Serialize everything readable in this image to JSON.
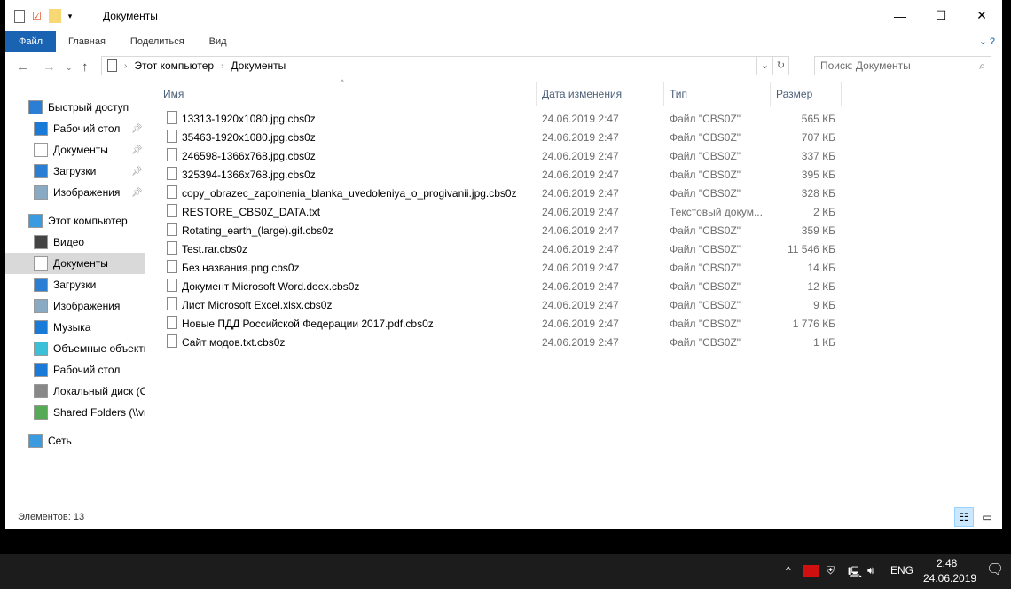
{
  "window": {
    "title": "Документы"
  },
  "ribbon": {
    "tabs": [
      "Файл",
      "Главная",
      "Поделиться",
      "Вид"
    ]
  },
  "address": {
    "crumbs": [
      "Этот компьютер",
      "Документы"
    ],
    "search_placeholder": "Поиск: Документы"
  },
  "sidebar": [
    {
      "label": "Быстрый доступ",
      "icon": "star-icon",
      "pinned": false
    },
    {
      "label": "Рабочий стол",
      "icon": "desktop-icon",
      "pinned": true
    },
    {
      "label": "Документы",
      "icon": "documents-icon",
      "pinned": true
    },
    {
      "label": "Загрузки",
      "icon": "downloads-icon",
      "pinned": true
    },
    {
      "label": "Изображения",
      "icon": "pictures-icon",
      "pinned": true
    },
    {
      "label": "Этот компьютер",
      "icon": "computer-icon",
      "pinned": false
    },
    {
      "label": "Видео",
      "icon": "video-icon",
      "pinned": false
    },
    {
      "label": "Документы",
      "icon": "documents-icon",
      "pinned": false
    },
    {
      "label": "Загрузки",
      "icon": "downloads-icon",
      "pinned": false
    },
    {
      "label": "Изображения",
      "icon": "pictures-icon",
      "pinned": false
    },
    {
      "label": "Музыка",
      "icon": "music-icon",
      "pinned": false
    },
    {
      "label": "Объемные объекты",
      "icon": "3d-objects-icon",
      "pinned": false
    },
    {
      "label": "Рабочий стол",
      "icon": "desktop-icon",
      "pinned": false
    },
    {
      "label": "Локальный диск (C:)",
      "icon": "drive-icon",
      "pinned": false
    },
    {
      "label": "Shared Folders (\\\\vmware-host)",
      "icon": "network-drive-icon",
      "pinned": false
    },
    {
      "label": "Сеть",
      "icon": "network-icon",
      "pinned": false
    }
  ],
  "columns": [
    "Имя",
    "Дата изменения",
    "Тип",
    "Размер"
  ],
  "files": [
    {
      "name": "13313-1920x1080.jpg.cbs0z",
      "date": "24.06.2019 2:47",
      "type": "Файл \"CBS0Z\"",
      "size": "565 КБ"
    },
    {
      "name": "35463-1920x1080.jpg.cbs0z",
      "date": "24.06.2019 2:47",
      "type": "Файл \"CBS0Z\"",
      "size": "707 КБ"
    },
    {
      "name": "246598-1366x768.jpg.cbs0z",
      "date": "24.06.2019 2:47",
      "type": "Файл \"CBS0Z\"",
      "size": "337 КБ"
    },
    {
      "name": "325394-1366x768.jpg.cbs0z",
      "date": "24.06.2019 2:47",
      "type": "Файл \"CBS0Z\"",
      "size": "395 КБ"
    },
    {
      "name": "copy_obrazec_zapolnenia_blanka_uvedoleniya_o_progivanii.jpg.cbs0z",
      "date": "24.06.2019 2:47",
      "type": "Файл \"CBS0Z\"",
      "size": "328 КБ"
    },
    {
      "name": "RESTORE_CBS0Z_DATA.txt",
      "date": "24.06.2019 2:47",
      "type": "Текстовый докум...",
      "size": "2 КБ"
    },
    {
      "name": "Rotating_earth_(large).gif.cbs0z",
      "date": "24.06.2019 2:47",
      "type": "Файл \"CBS0Z\"",
      "size": "359 КБ"
    },
    {
      "name": "Test.rar.cbs0z",
      "date": "24.06.2019 2:47",
      "type": "Файл \"CBS0Z\"",
      "size": "11 546 КБ"
    },
    {
      "name": "Без названия.png.cbs0z",
      "date": "24.06.2019 2:47",
      "type": "Файл \"CBS0Z\"",
      "size": "14 КБ"
    },
    {
      "name": "Документ Microsoft Word.docx.cbs0z",
      "date": "24.06.2019 2:47",
      "type": "Файл \"CBS0Z\"",
      "size": "12 КБ"
    },
    {
      "name": "Лист Microsoft Excel.xlsx.cbs0z",
      "date": "24.06.2019 2:47",
      "type": "Файл \"CBS0Z\"",
      "size": "9 КБ"
    },
    {
      "name": "Новые ПДД Российской Федерации 2017.pdf.cbs0z",
      "date": "24.06.2019 2:47",
      "type": "Файл \"CBS0Z\"",
      "size": "1 776 КБ"
    },
    {
      "name": "Сайт модов.txt.cbs0z",
      "date": "24.06.2019 2:47",
      "type": "Файл \"CBS0Z\"",
      "size": "1 КБ"
    }
  ],
  "status": {
    "items": "Элементов: 13"
  },
  "taskbar": {
    "lang": "ENG",
    "time": "2:48",
    "date": "24.06.2019"
  }
}
